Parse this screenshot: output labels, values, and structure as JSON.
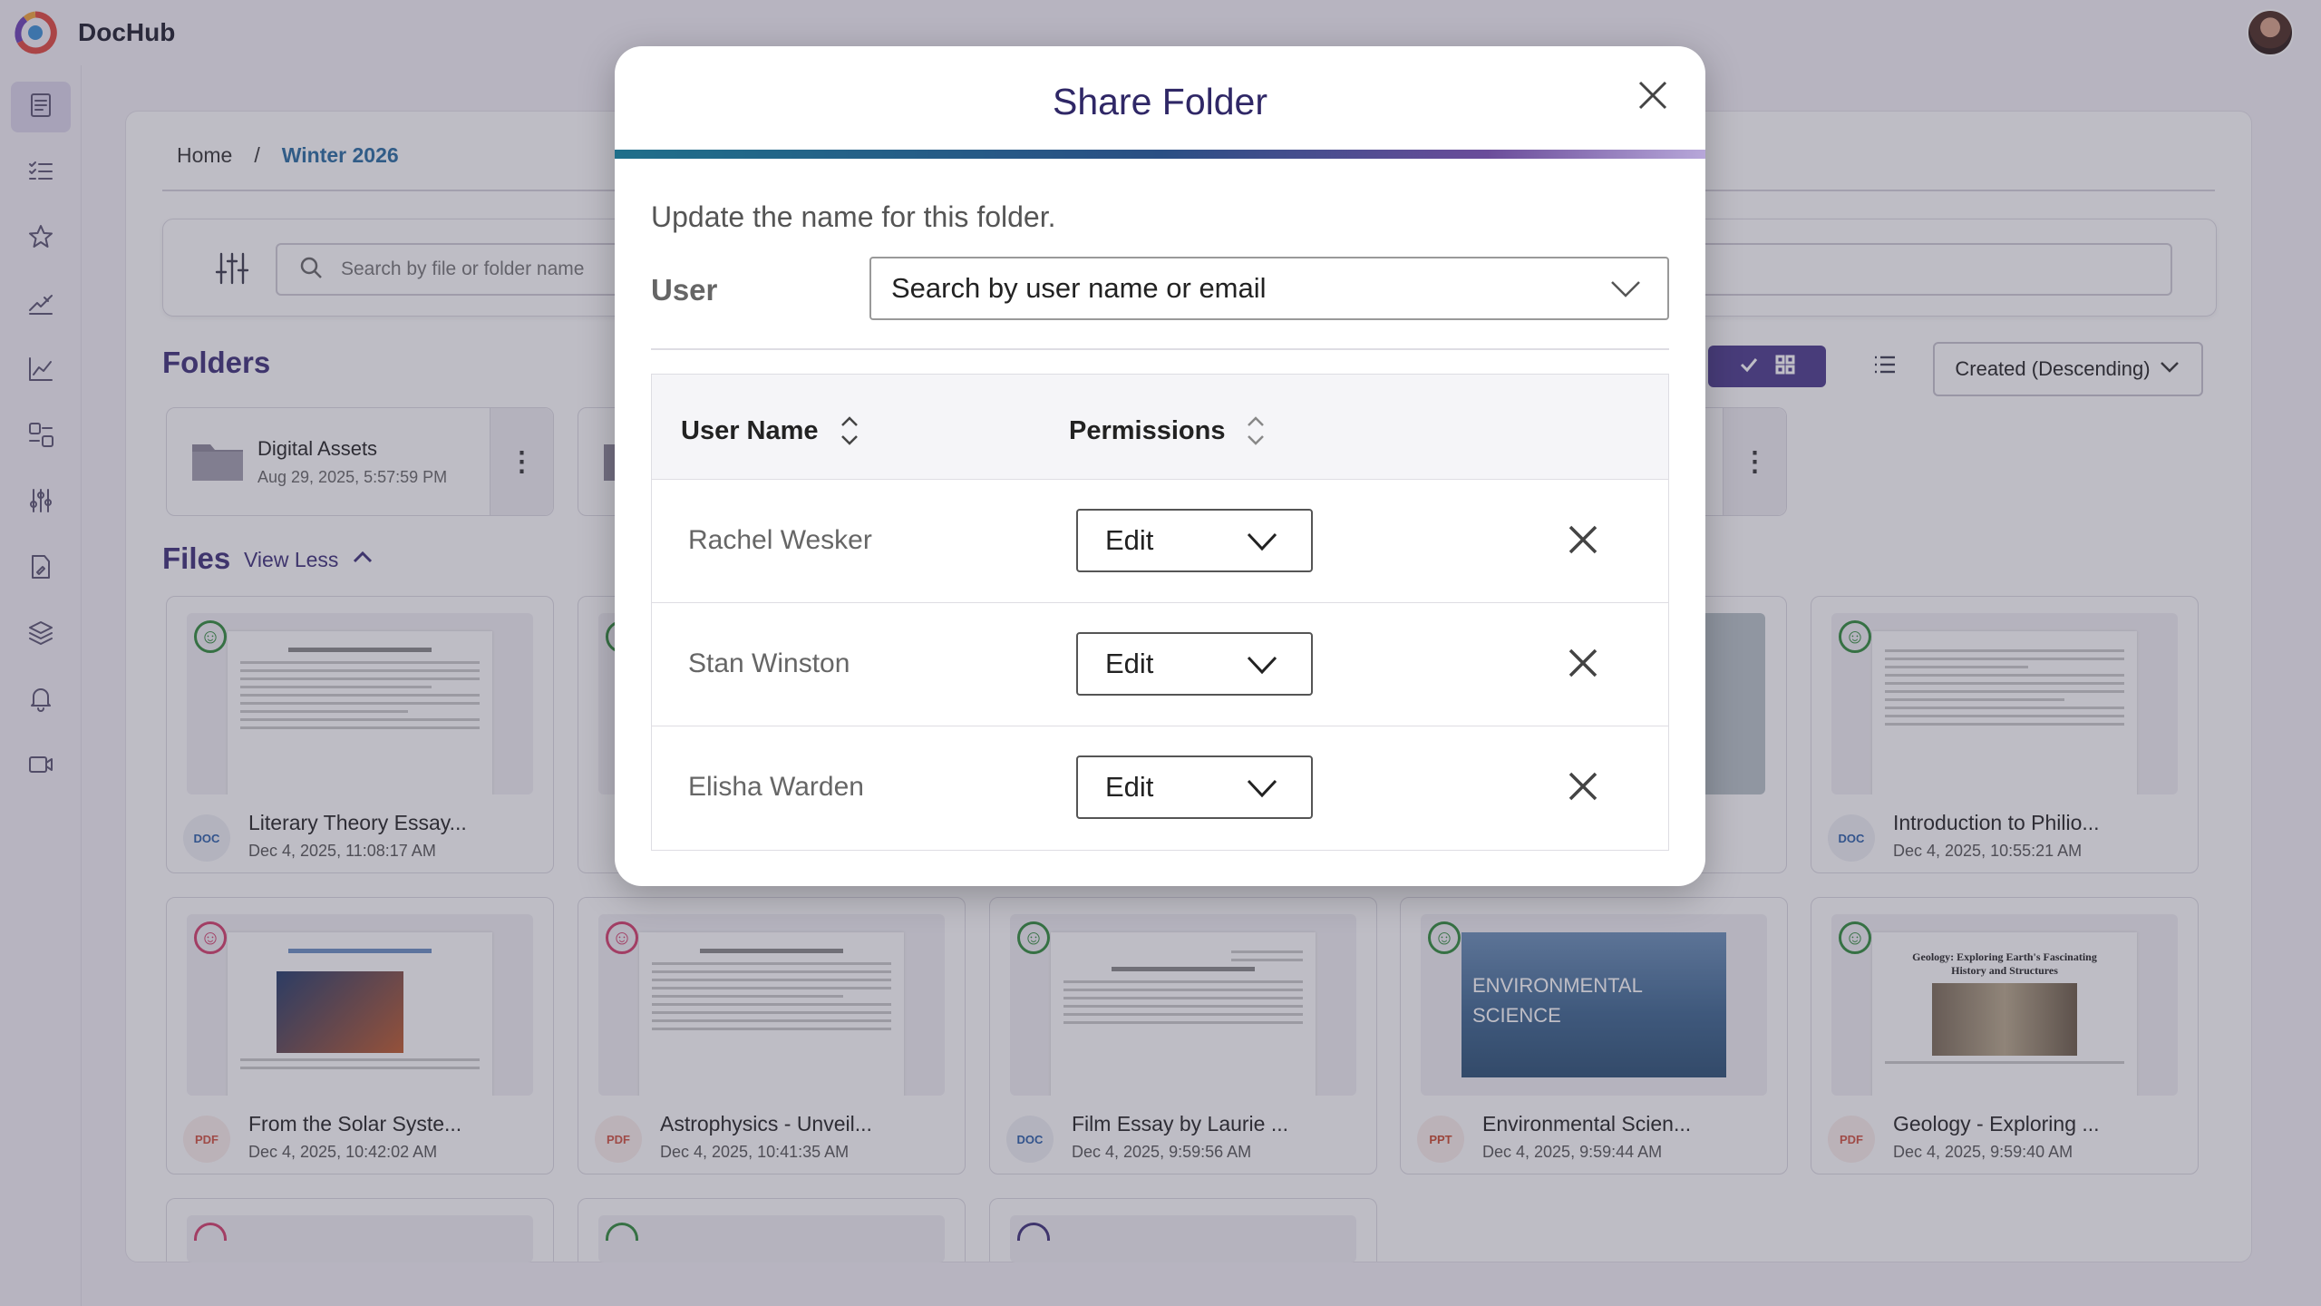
{
  "app": {
    "brand": "DocHub"
  },
  "sidebar": {
    "items": [
      {
        "icon": "document-icon",
        "active": true
      },
      {
        "icon": "checklist-icon",
        "active": false
      },
      {
        "icon": "star-icon",
        "active": false
      },
      {
        "icon": "signature-icon",
        "active": false
      },
      {
        "icon": "chart-line-icon",
        "active": false
      },
      {
        "icon": "templates-icon",
        "active": false
      },
      {
        "icon": "sliders-icon",
        "active": false
      },
      {
        "icon": "file-edit-icon",
        "active": false
      },
      {
        "icon": "layers-icon",
        "active": false
      },
      {
        "icon": "bell-icon",
        "active": false
      },
      {
        "icon": "video-icon",
        "active": false
      }
    ]
  },
  "breadcrumb": {
    "home": "Home",
    "separator": "/",
    "current": "Winter 2026"
  },
  "search": {
    "placeholder": "Search by file or folder name"
  },
  "folders": {
    "title": "Folders",
    "items": [
      {
        "name": "Digital Assets",
        "date": "Aug 29, 2025, 5:57:59 PM"
      }
    ]
  },
  "files": {
    "title": "Files",
    "view_less": "View Less",
    "items": [
      {
        "name": "Literary Theory Essay...",
        "date": "Dec 4, 2025, 11:08:17 AM",
        "type": "DOC",
        "status": "ok"
      },
      {
        "name": "Introduction to Philio...",
        "date": "Dec 4, 2025, 10:55:21 AM",
        "type": "DOC",
        "status": "ok"
      },
      {
        "name": "From the Solar Syste...",
        "date": "Dec 4, 2025, 10:42:02 AM",
        "type": "PDF",
        "status": "bad"
      },
      {
        "name": "Astrophysics - Unveil...",
        "date": "Dec 4, 2025, 10:41:35 AM",
        "type": "PDF",
        "status": "bad"
      },
      {
        "name": "Film Essay by Laurie ...",
        "date": "Dec 4, 2025, 9:59:56 AM",
        "type": "DOC",
        "status": "ok"
      },
      {
        "name": "Environmental Scien...",
        "date": "Dec 4, 2025, 9:59:44 AM",
        "type": "PPT",
        "status": "ok"
      },
      {
        "name": "Geology - Exploring ...",
        "date": "Dec 4, 2025, 9:59:40 AM",
        "type": "PDF",
        "status": "ok"
      }
    ],
    "thumb_text": {
      "environmental": "ENVIRONMENTAL SCIENCE",
      "geology": "Geology: Exploring Earth's Fascinating History and Structures"
    }
  },
  "sort": {
    "selected": "Created (Descending)"
  },
  "modal": {
    "title": "Share Folder",
    "description": "Update the name for this folder.",
    "user_label": "User",
    "user_placeholder": "Search by user name or email",
    "table": {
      "col_user": "User Name",
      "col_permissions": "Permissions",
      "rows": [
        {
          "name": "Rachel Wesker",
          "permission": "Edit"
        },
        {
          "name": "Stan Winston",
          "permission": "Edit"
        },
        {
          "name": "Elisha Warden",
          "permission": "Edit"
        }
      ]
    }
  }
}
